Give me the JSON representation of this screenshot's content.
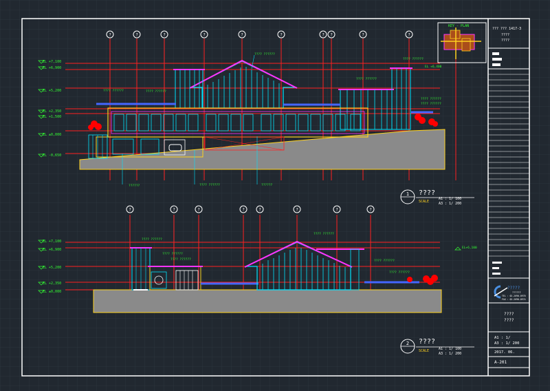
{
  "colors": {
    "background": "#212830",
    "grid": "#2c343d",
    "frame": "#ffffff",
    "axis_line": "#ff2020",
    "structure": "#00e5ff",
    "roof": "#ff33ff",
    "wall_outline": "#ffd21f",
    "annotation": "#33ff33",
    "ground_fill": "#8a8a8a",
    "tree": "#ff0000",
    "railing": "#4466ff"
  },
  "elevation_upper": {
    "axis_tags": [
      "?",
      "?",
      "?",
      "?",
      "?",
      "?",
      "?",
      "?",
      "?",
      "?",
      "?"
    ],
    "level_tags": [
      "EL +7,100",
      "EL +6,900",
      "EL +5,200",
      "EL +2,350",
      "EL +1,500",
      "EL ±0,000",
      "EL -0,650"
    ],
    "roof_note": "???? ??????",
    "callouts": [
      "???? ??????",
      "???? ??????",
      "???? ??????",
      "???? ??????",
      "???? ??????",
      "???? ??????",
      "??????",
      "???? ??????",
      "??????"
    ],
    "level_right": "EL +6,400",
    "title": "????",
    "scale_label": "SCALE",
    "scale_a1": "A1 : 1/ 100",
    "scale_a3": "A3 : 1/ 200",
    "number": "1"
  },
  "elevation_lower": {
    "axis_tags": [
      "?",
      "?",
      "?",
      "?",
      "?",
      "?",
      "?",
      "?"
    ],
    "level_tags": [
      "EL +7,100",
      "EL +6,900",
      "EL +5,200",
      "EL +2,350",
      "EL ±0,000"
    ],
    "callouts": [
      "???? ??????",
      "???? ??????",
      "???? ??????",
      "???? ??????",
      "???? ??????",
      "???? ??????"
    ],
    "level_right": "EL+6,100",
    "title": "????",
    "scale_label": "SCALE",
    "scale_a1": "A1 : 1/ 100",
    "scale_a3": "A3 : 1/ 200",
    "number": "2"
  },
  "key_plan": {
    "label": "KEY - PLAN"
  },
  "title_block": {
    "project_line1": "??? ??? 1417-3",
    "project_line2": "????",
    "project_line3": "????",
    "company_name": "?????",
    "company_sub": "??????",
    "company_tel": "TEL : 02-2690-0970",
    "company_fax": "FAX : 02-2690-0974",
    "drawing_title1": "????",
    "drawing_title2": "????",
    "scale_a1": "A1 : 1/",
    "scale_a3": "A3 : 1/ 200",
    "date": "2017. 06.",
    "sheet_no": "A-201"
  }
}
